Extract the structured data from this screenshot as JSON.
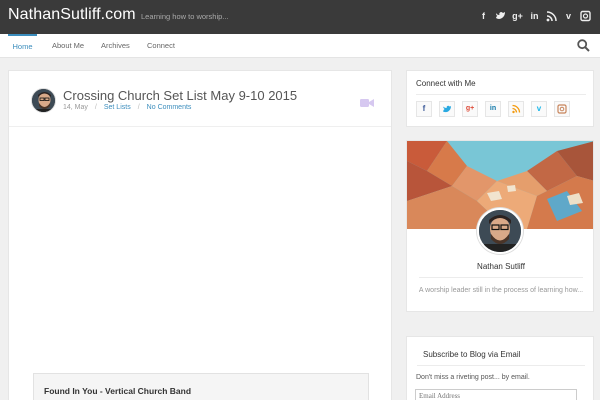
{
  "header": {
    "site_title": "NathanSutliff.com",
    "tagline": "Learning how to worship...",
    "social_icons": [
      "facebook-icon",
      "twitter-icon",
      "google-plus-icon",
      "linkedin-icon",
      "rss-icon",
      "vimeo-icon",
      "instagram-icon"
    ]
  },
  "nav": {
    "items": [
      "Home",
      "About Me",
      "Archives",
      "Connect"
    ],
    "active": "Home",
    "accent": "#3b8dbd"
  },
  "post": {
    "title": "Crossing Church Set List May 9-10 2015",
    "date": "14, May",
    "category": "Set Lists",
    "comments": "No Comments",
    "format_icon": "video-icon",
    "embed_title": "Found In You - Vertical Church Band"
  },
  "sidebar": {
    "connect": {
      "title": "Connect with Me",
      "icons": [
        {
          "icon": "facebook-icon",
          "glyph": "f",
          "color": "#3b5998"
        },
        {
          "icon": "twitter-icon",
          "glyph": "t",
          "color": "#29a9e1"
        },
        {
          "icon": "google-plus-icon",
          "glyph": "g+",
          "color": "#dd4b39"
        },
        {
          "icon": "linkedin-icon",
          "glyph": "in",
          "color": "#0e76a8"
        },
        {
          "icon": "rss-icon",
          "glyph": "◥",
          "color": "#f39c12"
        },
        {
          "icon": "vimeo-icon",
          "glyph": "v",
          "color": "#1ab7ea"
        },
        {
          "icon": "instagram-icon",
          "glyph": "▣",
          "color": "#c7845b"
        }
      ]
    },
    "profile": {
      "name": "Nathan Sutliff",
      "bio": "A worship leader still in the process of learning how..."
    },
    "subscribe": {
      "title": "Subscribe to Blog via Email",
      "text": "Don't miss a riveting post... by email.",
      "placeholder": "Email Address"
    }
  }
}
